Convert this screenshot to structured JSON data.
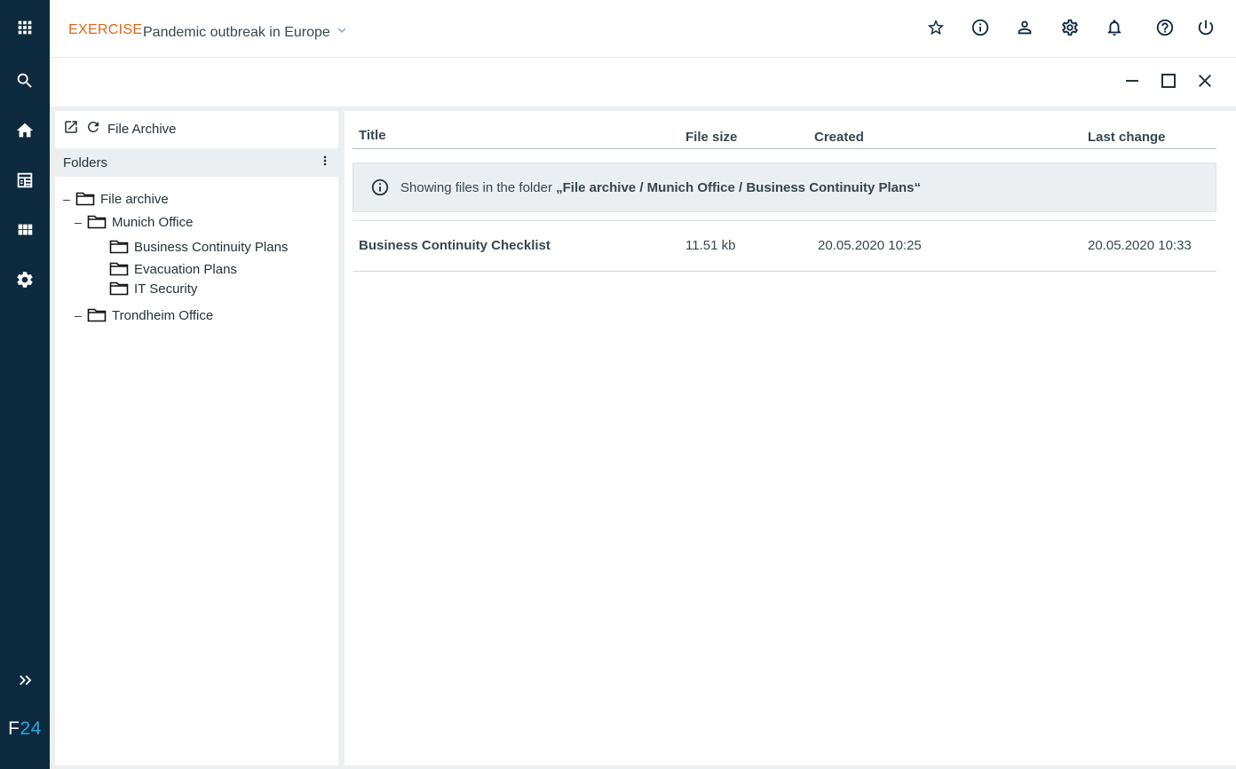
{
  "rail": {
    "items": [
      {
        "icon": "apps-grid-icon"
      },
      {
        "icon": "search-icon"
      },
      {
        "icon": "home-icon"
      },
      {
        "icon": "dashboard-icon"
      },
      {
        "icon": "modules-icon"
      },
      {
        "icon": "settings-icon"
      }
    ],
    "expand_icon": "double-chevron-right-icon",
    "logo_f": "F",
    "logo_n": "24",
    "logo_color_f": "#ffffff",
    "logo_color_n": "#29a8e0",
    "background": "#0d2a3f"
  },
  "header": {
    "mode_label": "EXERCISE",
    "mode_color": "#e0651a",
    "exercise_name": "Pandemic outbreak in Europe",
    "icons": [
      "star-icon",
      "info-icon",
      "user-icon",
      "settings-icon",
      "bell-icon",
      "help-icon",
      "power-icon"
    ]
  },
  "window": {
    "controls": [
      "minimize-icon",
      "maximize-icon",
      "close-icon"
    ]
  },
  "left_panel": {
    "title": "File Archive",
    "folders_label": "Folders",
    "tree": [
      {
        "label": "File archive",
        "toggle": "–",
        "level": 0
      },
      {
        "label": "Munich Office",
        "toggle": "–",
        "level": 1
      },
      {
        "label": "Business Continuity Plans",
        "toggle": "",
        "level": 2
      },
      {
        "label": "Evacuation Plans",
        "toggle": "",
        "level": 2
      },
      {
        "label": "IT Security",
        "toggle": "",
        "level": 2
      },
      {
        "label": "Trondheim Office",
        "toggle": "–",
        "level": 1
      }
    ]
  },
  "table": {
    "columns": [
      "Title",
      "File size",
      "Created",
      "Last change"
    ],
    "info_prefix": "Showing files in the folder ",
    "info_path": "„File archive / Munich Office / Business Continuity Plans“",
    "rows": [
      {
        "title": "Business Continuity Checklist",
        "size": "11.51 kb",
        "created": "20.05.2020 10:25",
        "changed": "20.05.2020 10:33"
      }
    ]
  }
}
